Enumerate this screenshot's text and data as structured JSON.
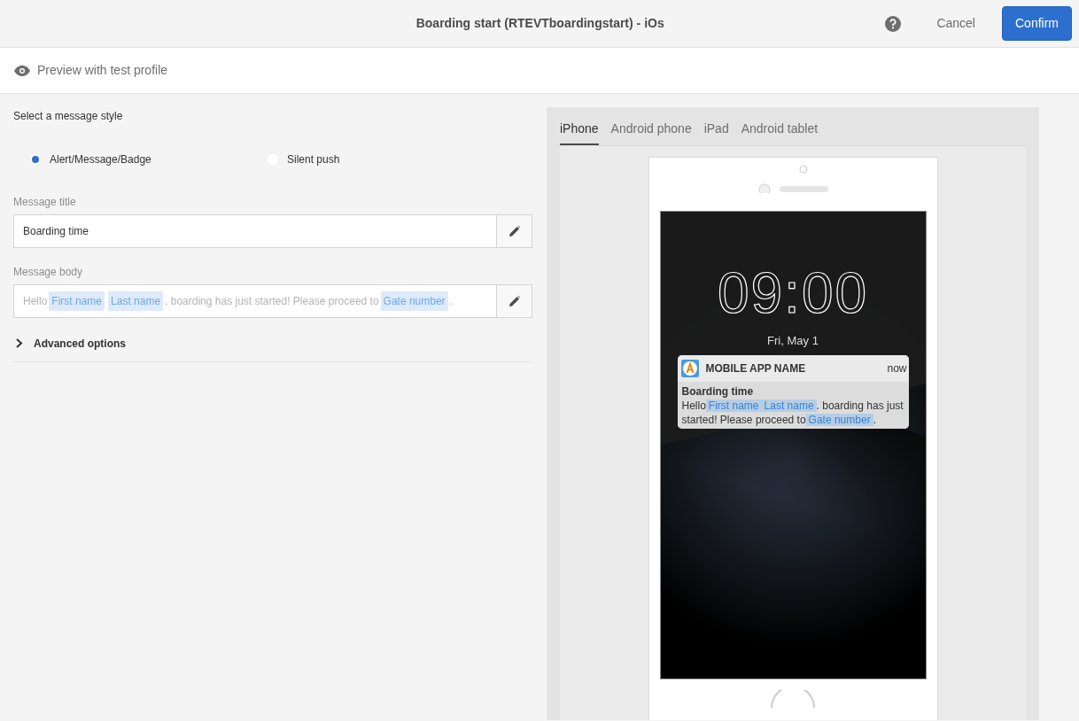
{
  "header": {
    "title": "Boarding start (RTEVTboardingstart) - iOs",
    "buttons": [
      {
        "label": "Cancel",
        "kind": "quiet"
      },
      {
        "label": "Confirm",
        "kind": "primary"
      }
    ]
  },
  "preview_bar": {
    "label": "Preview with test profile"
  },
  "message_style": {
    "label": "Select a message style",
    "options": [
      {
        "label": "Alert/Message/Badge",
        "selected": true
      },
      {
        "label": "Silent push",
        "selected": false
      }
    ]
  },
  "fields": [
    {
      "label": "Message title",
      "dimmed": false,
      "parts": [
        {
          "kind": "text",
          "text": "Boarding time"
        }
      ]
    },
    {
      "label": "Message body",
      "dimmed": true,
      "parts": [
        {
          "kind": "text",
          "text": "Hello"
        },
        {
          "kind": "token",
          "text": "First name"
        },
        {
          "kind": "token",
          "text": "Last name"
        },
        {
          "kind": "text",
          "text": ", boarding has just started! Please proceed to"
        },
        {
          "kind": "token",
          "text": "Gate number"
        },
        {
          "kind": "text",
          "text": "."
        }
      ]
    }
  ],
  "advanced": {
    "label": "Advanced options",
    "expanded": false
  },
  "preview": {
    "tabs": [
      {
        "label": "iPhone",
        "selected": true
      },
      {
        "label": "Android phone",
        "selected": false
      },
      {
        "label": "iPad",
        "selected": false
      },
      {
        "label": "Android tablet",
        "selected": false
      }
    ],
    "clock": "09:00",
    "date": "Fri, May 1",
    "notification": {
      "app": "MOBILE APP NAME",
      "time": "now",
      "title": "Boarding time",
      "parts": [
        {
          "kind": "text",
          "text": "Hello"
        },
        {
          "kind": "token",
          "text": "First name"
        },
        {
          "kind": "token",
          "text": "Last name"
        },
        {
          "kind": "text",
          "text": ". boarding has just started! Please proceed to"
        },
        {
          "kind": "token",
          "text": "Gate number"
        },
        {
          "kind": "text",
          "text": "."
        }
      ]
    }
  }
}
